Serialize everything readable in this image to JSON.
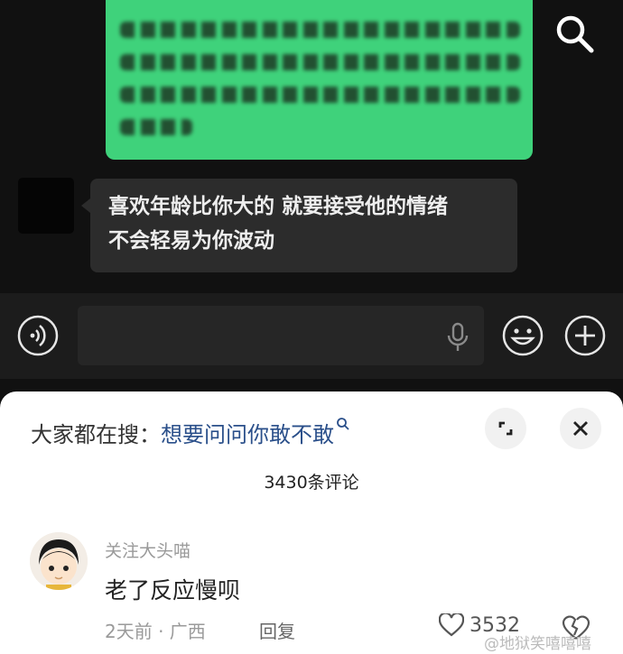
{
  "chat": {
    "message_text_line1": "喜欢年龄比你大的 就要接受他的情绪",
    "message_text_line2": "不会轻易为你波动"
  },
  "input_bar": {
    "voice_icon": "voice-icon",
    "mic_icon": "microphone-icon",
    "emoji_icon": "emoji-icon",
    "plus_icon": "plus-icon"
  },
  "comments_sheet": {
    "search_prefix": "大家都在搜：",
    "search_term": "想要问问你敢不敢",
    "comment_count": "3430条评论",
    "comment": {
      "user": "关注大头喵",
      "text": "老了反应慢呗",
      "meta": "2天前 · 广西",
      "reply_label": "回复",
      "likes": "3532"
    },
    "watermark": "@地狱笑嘻嘻嘻"
  },
  "colors": {
    "green_bubble": "#3fd27b",
    "gray_bubble": "#2c2c2c",
    "link_blue": "#2a4f8a"
  }
}
